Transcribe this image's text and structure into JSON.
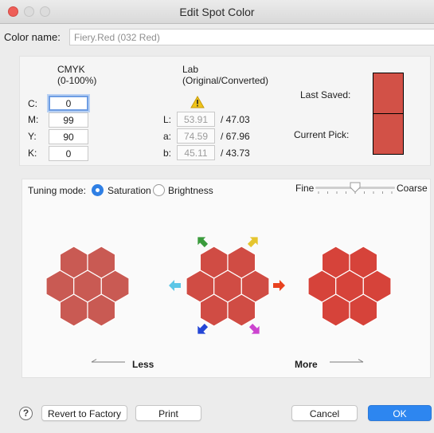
{
  "window": {
    "title": "Edit Spot Color"
  },
  "color_name": {
    "label": "Color name:",
    "value": "Fiery.Red (032 Red)"
  },
  "cmyk": {
    "heading": "CMYK",
    "subheading": "(0-100%)",
    "fields": [
      {
        "label": "C:",
        "value": "0"
      },
      {
        "label": "M:",
        "value": "99"
      },
      {
        "label": "Y:",
        "value": "90"
      },
      {
        "label": "K:",
        "value": "0"
      }
    ]
  },
  "lab": {
    "heading": "Lab",
    "subheading": "(Original/Converted)",
    "fields": [
      {
        "label": "L:",
        "original": "53.91",
        "converted": "/ 47.03"
      },
      {
        "label": "a:",
        "original": "74.59",
        "converted": "/ 67.96"
      },
      {
        "label": "b:",
        "original": "45.11",
        "converted": "/ 43.73"
      }
    ]
  },
  "swatches": {
    "last_saved": "Last Saved:",
    "current_pick": "Current Pick:"
  },
  "tuning": {
    "label": "Tuning mode:",
    "saturation": "Saturation",
    "brightness": "Brightness",
    "selected": "Saturation"
  },
  "step_slider": {
    "fine": "Fine",
    "coarse": "Coarse",
    "level": 0.5
  },
  "direction": {
    "less": "Less",
    "more": "More"
  },
  "buttons": {
    "revert": "Revert to Factory",
    "print": "Print",
    "cancel": "Cancel",
    "ok": "OK",
    "help": "?"
  },
  "colors": {
    "swatch": "#d25147",
    "hex_less": "#c95a53",
    "hex_center": "#d04c44",
    "hex_more": "#d6433a",
    "arrow_up_left": "#3a9b3c",
    "arrow_up_right": "#e5c52e",
    "arrow_left": "#5cc6e6",
    "arrow_right": "#e8421f",
    "arrow_down_left": "#2446d6",
    "arrow_down_right": "#cc44cf",
    "accent": "#2f7fe4"
  },
  "icons": {
    "warning": "warning-icon"
  }
}
